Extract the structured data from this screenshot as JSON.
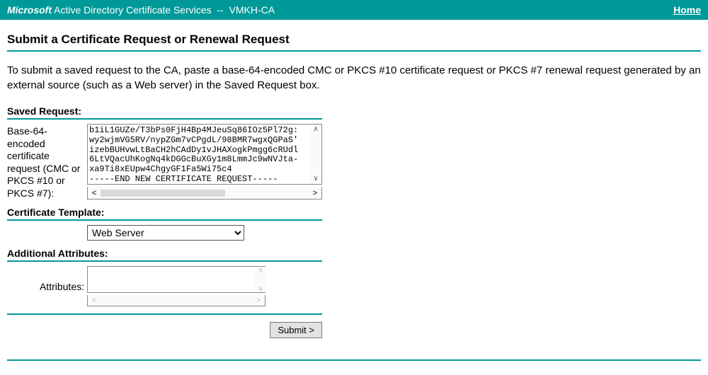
{
  "header": {
    "brand": "Microsoft",
    "service": "Active Directory Certificate Services",
    "separator": "--",
    "ca_name": "VMKH-CA",
    "home_link": "Home"
  },
  "page": {
    "title": "Submit a Certificate Request or Renewal Request",
    "instructions": "To submit a saved request to the CA, paste a base-64-encoded CMC or PKCS #10 certificate request or PKCS #7 renewal request generated by an external source (such as a Web server) in the Saved Request box."
  },
  "saved_request": {
    "heading": "Saved Request:",
    "label": "Base-64-encoded certificate request (CMC or PKCS #10 or PKCS #7):",
    "value": "b1iL1GUZe/T3bPs0FjH4Bp4MJeuSq86IOz5Pl72g:\nwy2wjmVG5RV/nypZGm7vCPgdL/98BMR7wgxQGPaS'\nizebBUHvwLtBaCH2hCAdDy1vJHAXogkPmgg6cRUdl\n6LtVQacUhKogNq4kDGGcBuXGy1m8LmmJc9wNVJta-\nxa9Ti8xEUpw4ChgyGF1Fa5Wi75c4\n-----END NEW CERTIFICATE REQUEST-----"
  },
  "template": {
    "heading": "Certificate Template:",
    "selected": "Web Server"
  },
  "attributes": {
    "heading": "Additional Attributes:",
    "label": "Attributes:",
    "value": ""
  },
  "buttons": {
    "submit": "Submit >"
  }
}
